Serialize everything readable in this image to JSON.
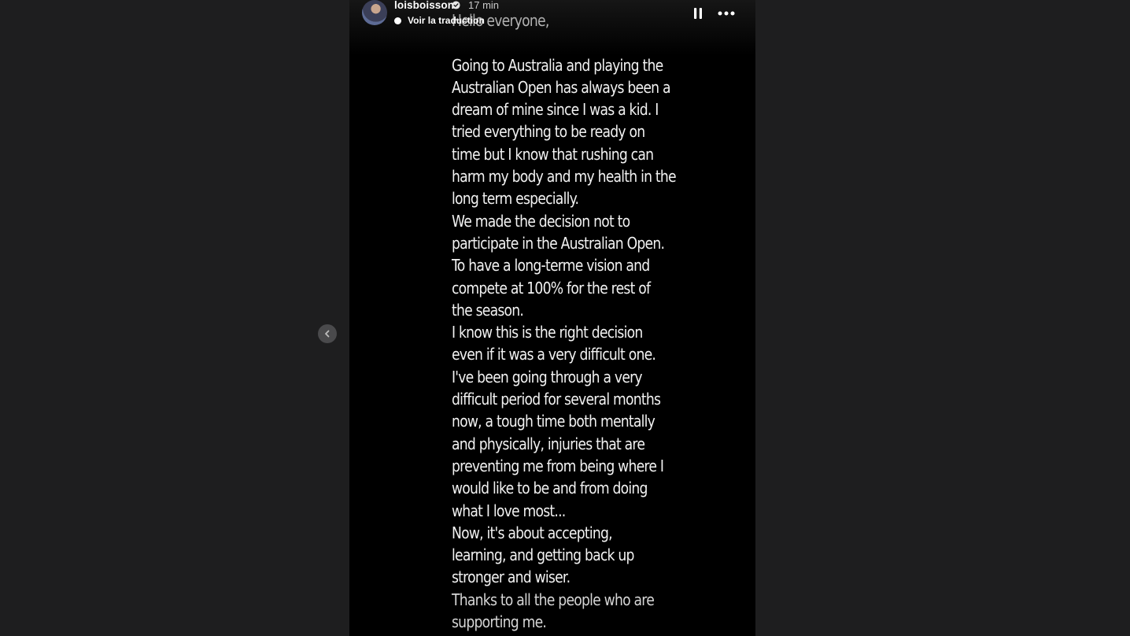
{
  "story": {
    "username": "loisboisson",
    "time": "17 min",
    "translate_label": "Voir la traduction",
    "lines": [
      "Hello everyone,",
      "",
      "Going to Australia and playing the",
      "Australian Open has always been a",
      "dream of mine since I was a kid. I",
      "tried everything to be ready on",
      "time but I know that rushing can",
      "harm my body and my health in the",
      "long term especially.",
      "We made the decision not to",
      "participate in the Australian Open.",
      "To have a long-terme vision and",
      "compete at 100% for the rest of",
      "the season.",
      "I know this is the right decision",
      "even if it was a very difficult one.",
      "I've been going through a very",
      "difficult period for several months",
      "now, a tough time both mentally",
      "and physically, injuries that are",
      "preventing me from being where I",
      "would like to be and from doing",
      "what I love most...",
      "Now, it's about accepting,",
      "learning, and getting back up",
      "stronger and wiser.",
      "Thanks to all the people who are",
      "supporting me."
    ]
  },
  "icons": {
    "prev": "chevron-left-icon",
    "verified": "verified-badge-icon",
    "pause": "pause-icon",
    "more": "more-options-icon",
    "translate": "translate-icon"
  }
}
